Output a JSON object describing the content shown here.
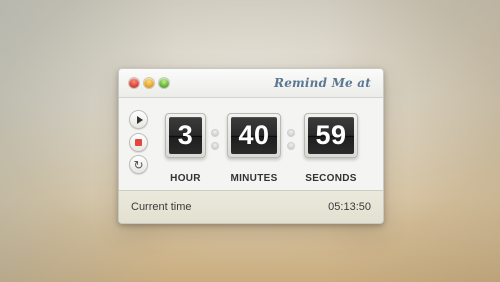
{
  "window": {
    "title": "Remind Me at",
    "buttons": {
      "close_icon": "close-icon",
      "minimize_icon": "minimize-icon",
      "zoom_icon": "zoom-icon"
    }
  },
  "controls": {
    "play_icon": "play-icon",
    "stop_icon": "stop-icon",
    "reset_icon": "reset-icon",
    "reset_glyph": "↻"
  },
  "timer": {
    "hours": {
      "value": "3",
      "label": "HOUR"
    },
    "minutes": {
      "value": "40",
      "label": "MINUTES"
    },
    "seconds": {
      "value": "59",
      "label": "SECONDS"
    }
  },
  "footer": {
    "label": "Current time",
    "time": "05:13:50"
  },
  "colors": {
    "title": "#5a7794",
    "stop_accent": "#e2463c",
    "close": "#d23b2c",
    "minimize": "#e29b1e",
    "zoom": "#56a82c"
  }
}
